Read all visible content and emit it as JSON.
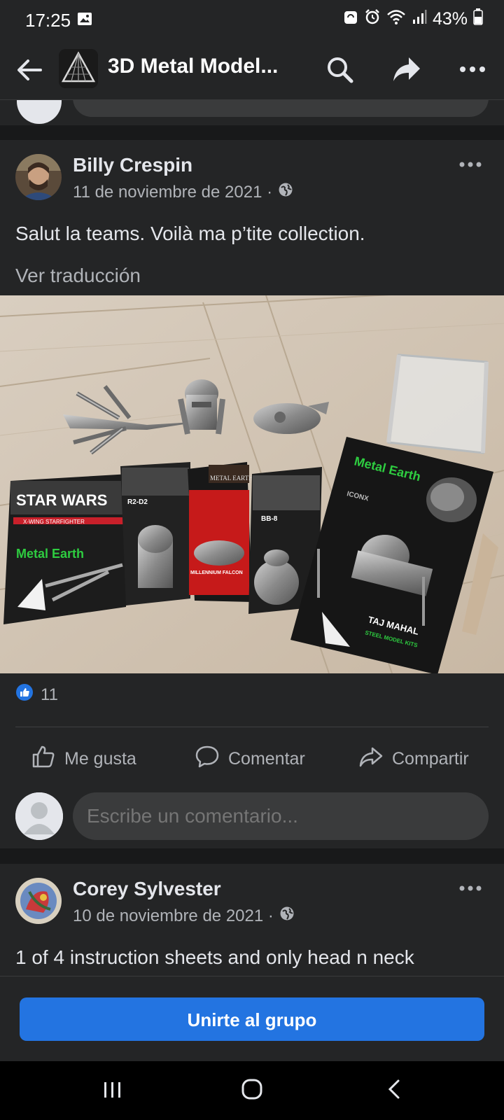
{
  "status_bar": {
    "time": "17:25",
    "battery": "43%",
    "icons": [
      "gallery-icon",
      "sync-icon",
      "alarm-icon",
      "wifi-icon",
      "signal-icon",
      "battery-icon"
    ]
  },
  "header": {
    "group_title": "3D Metal Model...",
    "icons": [
      "back-arrow-icon",
      "search-icon",
      "share-icon",
      "more-icon"
    ]
  },
  "posts": [
    {
      "author": "Billy Crespin",
      "date": "11 de noviembre de 2021 ·",
      "text": "Salut la teams. Voilà ma p’tite collection.",
      "see_translation": "Ver traducción",
      "photo_labels": {
        "kit1_brand": "STAR WARS",
        "kit1_sub": "X-WING STARFIGHTER",
        "metal_earth": "Metal Earth",
        "kit2_sub": "R2-D2",
        "kit3_brand": "METAL EARTH",
        "kit3_sub": "MILLENNIUM FALCON",
        "kit4_sub": "BB-8",
        "kit5_series": "ICONX",
        "kit5_sub": "TAJ MAHAL",
        "kit5_tag": "STEEL MODEL KITS"
      },
      "reactions_count": "11",
      "actions": {
        "like": "Me gusta",
        "comment": "Comentar",
        "share": "Compartir"
      },
      "comment_placeholder": "Escribe un comentario..."
    },
    {
      "author": "Corey Sylvester",
      "date": "10 de noviembre de 2021 ·",
      "text": "1 of 4 instruction sheets and only head n neck"
    }
  ],
  "join_button": "Unirte al grupo",
  "colors": {
    "background": "#18191a",
    "card": "#242526",
    "accent": "#2374e1",
    "text_secondary": "#b0b3b8"
  }
}
